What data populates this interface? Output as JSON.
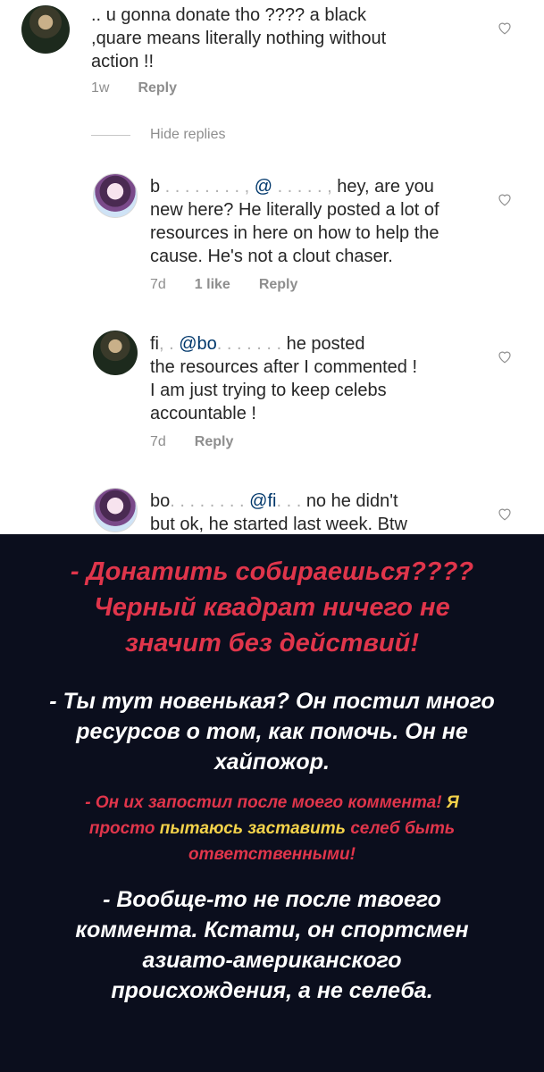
{
  "comments": [
    {
      "username": "..",
      "text": "u gonna donate tho ???? a black square means literally nothing without action !!",
      "line1": "u gonna donate tho ???? a black",
      "line2": "quare means literally nothing without",
      "line3": "action !!",
      "time": "1w",
      "reply_label": "Reply"
    },
    {
      "username": "b",
      "mention": "@",
      "line1": "hey, are you",
      "line2": "new here? He literally posted a lot of",
      "line3": "resources in here on how to help the",
      "line4": "cause. He's not a clout chaser.",
      "time": "7d",
      "likes": "1 like",
      "reply_label": "Reply"
    },
    {
      "username": "fi",
      "mention": "@bo",
      "line1": "he posted",
      "line2": "the resources after I commented !",
      "line3": "I am just trying to keep celebs",
      "line4": "accountable !",
      "time": "7d",
      "reply_label": "Reply"
    },
    {
      "username": "bo",
      "mention": "@fi",
      "line1": "no he didn't",
      "line2": "but ok, he started last week. Btw"
    }
  ],
  "hide_replies_label": "Hide replies",
  "translation": {
    "block1": [
      "- Донатить собираешься????",
      "Черный квадрат ничего не",
      "значит без действий!"
    ],
    "block2": [
      "- Ты тут новенькая? Он постил много",
      "ресурсов о том, как помочь. Он не",
      "хайпожор."
    ],
    "block3_line1_red": "- Он их запостил после моего коммента!",
    "block3_line1_yellow": " Я",
    "block3_line2_red_a": "просто ",
    "block3_line2_yellow": "пытаюсь заставить",
    "block3_line2_red_b": " селеб быть",
    "block3_line3": "ответственными!",
    "block4": [
      "- Вообще-то не после твоего",
      "коммента. Кстати, он спортсмен",
      "азиато-американского",
      "происхождения, а не селеба."
    ]
  },
  "colors": {
    "translation_bg": "#0b0e1d",
    "red": "#e0354b",
    "yellow": "#f3d24a",
    "mention": "#00376b"
  }
}
